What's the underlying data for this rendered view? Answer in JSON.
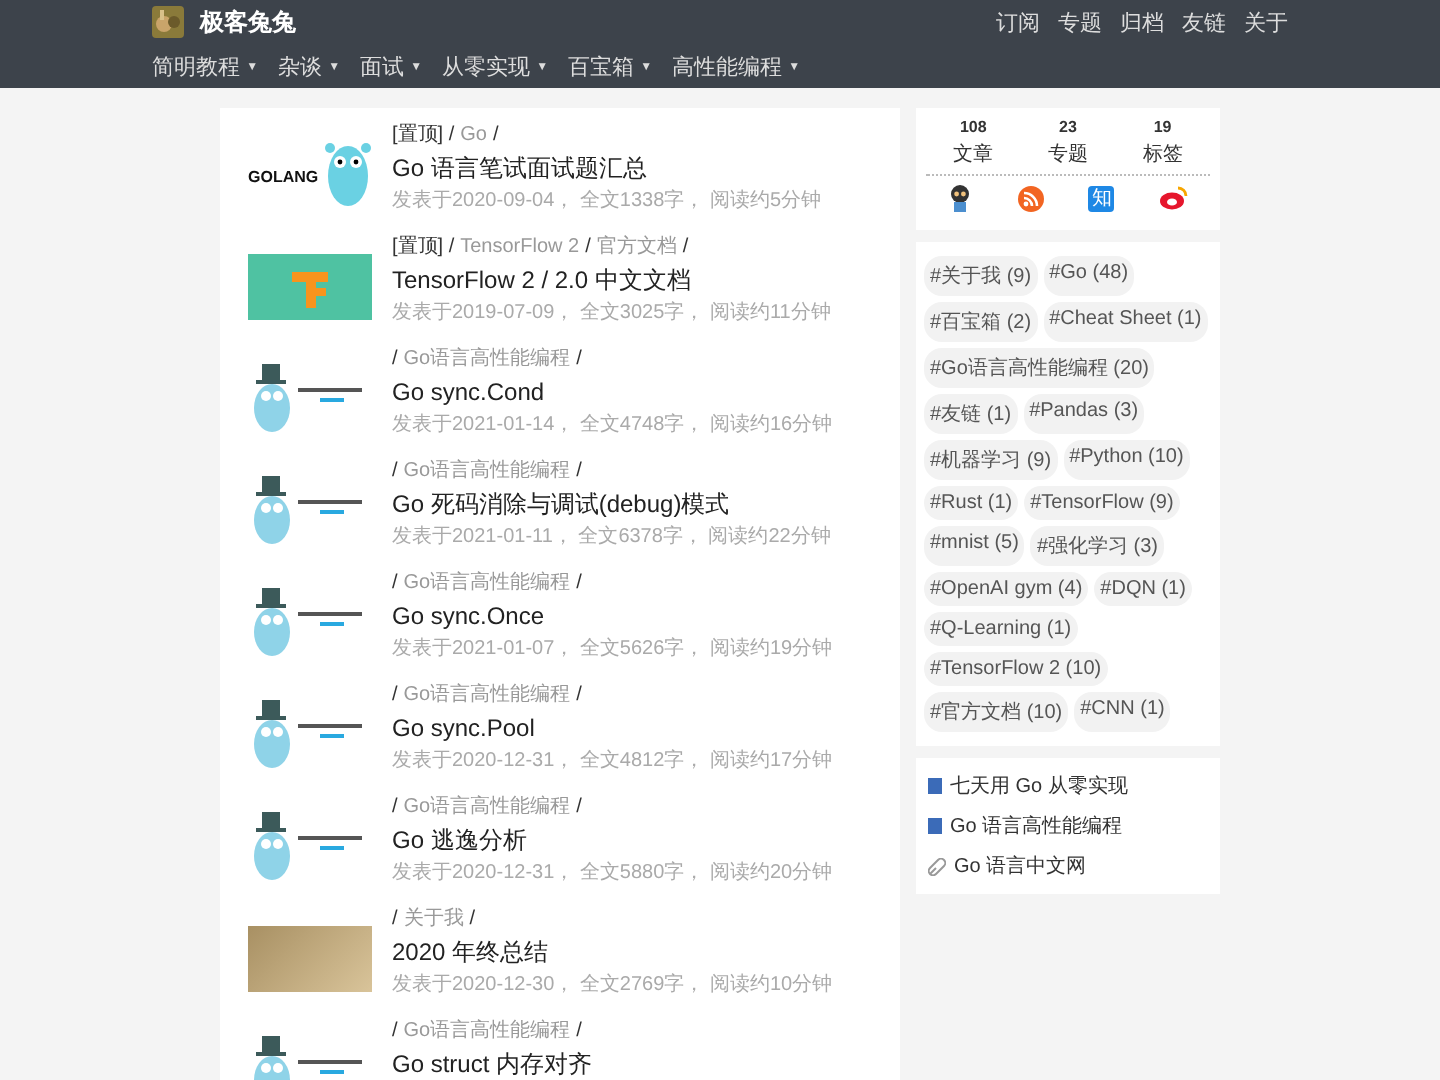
{
  "site": {
    "title": "极客兔兔"
  },
  "top_links": [
    "订阅",
    "专题",
    "归档",
    "友链",
    "关于"
  ],
  "menu": [
    "简明教程",
    "杂谈",
    "面试",
    "从零实现",
    "百宝箱",
    "高性能编程"
  ],
  "menu_caret": "▼",
  "posts": [
    {
      "kind": "golang",
      "thumb_text": "GOLANG",
      "category": [
        {
          "kind": "text",
          "text": "[置顶] /"
        },
        {
          "kind": "link",
          "text": "Go"
        },
        {
          "kind": "text",
          "text": "/"
        }
      ],
      "title": "Go 语言笔试面试题汇总",
      "meta": "发表于2020-09-04， 全文1338字， 阅读约5分钟"
    },
    {
      "kind": "tensorflow",
      "category": [
        {
          "kind": "text",
          "text": "[置顶] /"
        },
        {
          "kind": "link",
          "text": "TensorFlow 2"
        },
        {
          "kind": "text",
          "text": "/"
        },
        {
          "kind": "link",
          "text": "官方文档"
        },
        {
          "kind": "text",
          "text": "/"
        }
      ],
      "title": "TensorFlow 2 / 2.0 中文文档",
      "meta": "发表于2019-07-09， 全文3025字， 阅读约11分钟"
    },
    {
      "kind": "gopher",
      "category": [
        {
          "kind": "text",
          "text": "/"
        },
        {
          "kind": "link",
          "text": "Go语言高性能编程"
        },
        {
          "kind": "text",
          "text": "/"
        }
      ],
      "title": "Go sync.Cond",
      "meta": "发表于2021-01-14， 全文4748字， 阅读约16分钟"
    },
    {
      "kind": "gopher",
      "category": [
        {
          "kind": "text",
          "text": "/"
        },
        {
          "kind": "link",
          "text": "Go语言高性能编程"
        },
        {
          "kind": "text",
          "text": "/"
        }
      ],
      "title": "Go 死码消除与调试(debug)模式",
      "meta": "发表于2021-01-11， 全文6378字， 阅读约22分钟"
    },
    {
      "kind": "gopher",
      "category": [
        {
          "kind": "text",
          "text": "/"
        },
        {
          "kind": "link",
          "text": "Go语言高性能编程"
        },
        {
          "kind": "text",
          "text": "/"
        }
      ],
      "title": "Go sync.Once",
      "meta": "发表于2021-01-07， 全文5626字， 阅读约19分钟"
    },
    {
      "kind": "gopher",
      "category": [
        {
          "kind": "text",
          "text": "/"
        },
        {
          "kind": "link",
          "text": "Go语言高性能编程"
        },
        {
          "kind": "text",
          "text": "/"
        }
      ],
      "title": "Go sync.Pool",
      "meta": "发表于2020-12-31， 全文4812字， 阅读约17分钟"
    },
    {
      "kind": "gopher",
      "category": [
        {
          "kind": "text",
          "text": "/"
        },
        {
          "kind": "link",
          "text": "Go语言高性能编程"
        },
        {
          "kind": "text",
          "text": "/"
        }
      ],
      "title": "Go 逃逸分析",
      "meta": "发表于2020-12-31， 全文5880字， 阅读约20分钟"
    },
    {
      "kind": "photo",
      "category": [
        {
          "kind": "text",
          "text": "/"
        },
        {
          "kind": "link",
          "text": "关于我"
        },
        {
          "kind": "text",
          "text": "/"
        }
      ],
      "title": "2020 年终总结",
      "meta": "发表于2020-12-30， 全文2769字， 阅读约10分钟"
    },
    {
      "kind": "gopher",
      "category": [
        {
          "kind": "text",
          "text": "/"
        },
        {
          "kind": "link",
          "text": "Go语言高性能编程"
        },
        {
          "kind": "text",
          "text": "/"
        }
      ],
      "title": "Go struct 内存对齐"
    }
  ],
  "stats": [
    {
      "count": "108",
      "label": "文章"
    },
    {
      "count": "23",
      "label": "专题"
    },
    {
      "count": "19",
      "label": "标签"
    }
  ],
  "social": [
    {
      "kind": "github"
    },
    {
      "kind": "rss"
    },
    {
      "kind": "zhihu",
      "text": "知"
    },
    {
      "kind": "weibo"
    }
  ],
  "tags": [
    "#关于我 (9)",
    "#Go (48)",
    "#百宝箱 (2)",
    "#Cheat Sheet (1)",
    "#Go语言高性能编程 (20)",
    "#友链 (1)",
    "#Pandas (3)",
    "#机器学习 (9)",
    "#Python (10)",
    "#Rust (1)",
    "#TensorFlow (9)",
    "#mnist (5)",
    "#强化学习 (3)",
    "#OpenAI gym (4)",
    "#DQN (1)",
    "#Q-Learning (1)",
    "#TensorFlow 2 (10)",
    "#官方文档 (10)",
    "#CNN (1)"
  ],
  "links": [
    {
      "kind": "book",
      "text": "七天用 Go 从零实现"
    },
    {
      "kind": "book",
      "text": "Go 语言高性能编程"
    },
    {
      "kind": "link",
      "text": "Go 语言中文网"
    }
  ]
}
